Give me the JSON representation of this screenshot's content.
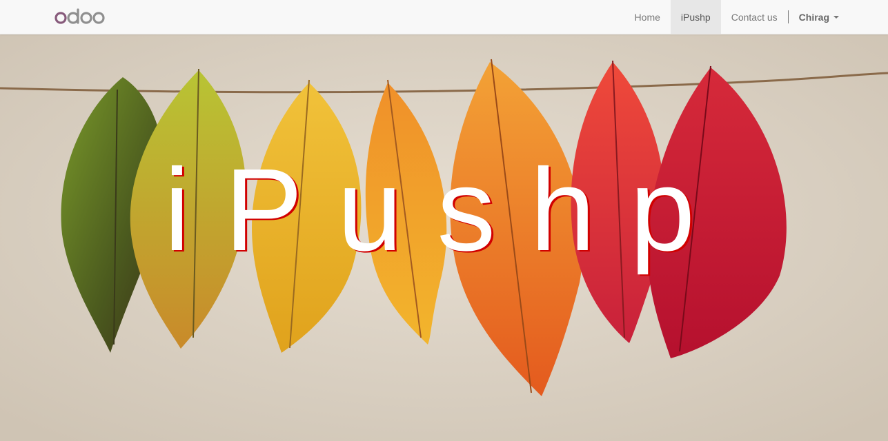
{
  "navbar": {
    "logo_alt": "odoo",
    "items": [
      {
        "label": "Home",
        "active": false
      },
      {
        "label": "iPushp",
        "active": true
      },
      {
        "label": "Contact us",
        "active": false
      }
    ],
    "user": {
      "label": "Chirag"
    }
  },
  "hero": {
    "title": "iPushp",
    "title_color": "#ffffff",
    "shadow_color": "#d10000",
    "background": "leaves-on-string-image"
  },
  "colors": {
    "navbar_bg": "#f8f8f8",
    "nav_active_bg": "#e7e7e7",
    "logo_purple": "#875a7b",
    "logo_gray": "#8f8f8f"
  }
}
